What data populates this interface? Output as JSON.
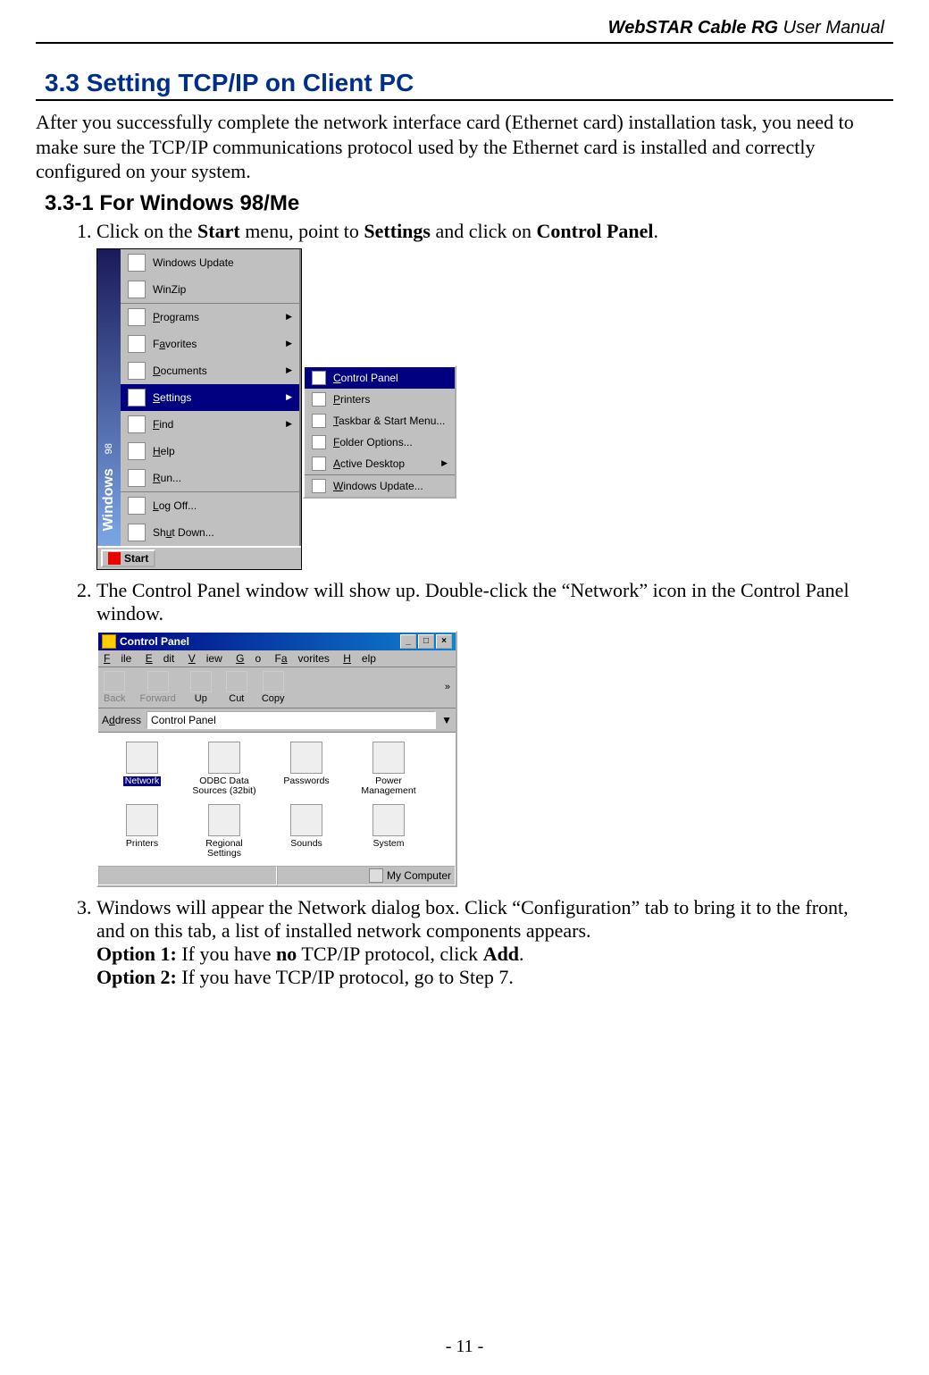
{
  "header": {
    "product": "WebSTAR Cable RG",
    "rest": " User Manual"
  },
  "section": {
    "title": "3.3 Setting TCP/IP on Client PC",
    "intro": "After you successfully complete the network interface card (Ethernet card) installation task, you need to make sure the TCP/IP communications protocol used by the Ethernet card is installed and correctly configured on your system.",
    "sub": "3.3-1 For Windows 98/Me"
  },
  "steps": {
    "s1": {
      "a": "Click on the ",
      "b": "Start",
      "c": " menu, point to ",
      "d": "Settings",
      "e": " and click on ",
      "f": "Control Panel",
      "g": "."
    },
    "s2": "The Control Panel window will show up. Double-click the “Network” icon in the Control Panel window.",
    "s3": {
      "l1": "Windows will appear the Network dialog box. Click “Configuration” tab to bring it to the front, and on this tab, a list of installed network components appears.",
      "o1a": "Option 1:",
      "o1b": " If you have ",
      "o1c": "no",
      "o1d": " TCP/IP protocol, click ",
      "o1e": "Add",
      "o1f": ".",
      "o2a": "Option 2:",
      "o2b": " If you have TCP/IP protocol, go to Step 7."
    }
  },
  "startmenu": {
    "sidebar": {
      "brand": "Windows",
      "ver": "98"
    },
    "items": [
      {
        "label": "Windows Update",
        "arrow": false
      },
      {
        "label": "WinZip",
        "arrow": false
      },
      {
        "label": "Programs",
        "arrow": true
      },
      {
        "label": "Favorites",
        "arrow": true
      },
      {
        "label": "Documents",
        "arrow": true
      },
      {
        "label": "Settings",
        "arrow": true
      },
      {
        "label": "Find",
        "arrow": true
      },
      {
        "label": "Help",
        "arrow": false
      },
      {
        "label": "Run...",
        "arrow": false
      },
      {
        "label": "Log Off...",
        "arrow": false
      },
      {
        "label": "Shut Down...",
        "arrow": false
      }
    ],
    "submenu": [
      {
        "label": "Control Panel",
        "arrow": false
      },
      {
        "label": "Printers",
        "arrow": false
      },
      {
        "label": "Taskbar & Start Menu...",
        "arrow": false
      },
      {
        "label": "Folder Options...",
        "arrow": false
      },
      {
        "label": "Active Desktop",
        "arrow": true
      },
      {
        "label": "Windows Update...",
        "arrow": false
      }
    ],
    "start": "Start"
  },
  "cp": {
    "title": "Control Panel",
    "menu": [
      "File",
      "Edit",
      "View",
      "Go",
      "Favorites",
      "Help"
    ],
    "tools": [
      "Back",
      "Forward",
      "Up",
      "Cut",
      "Copy"
    ],
    "addr_label": "Address",
    "addr_value": "Control Panel",
    "icons": [
      "Network",
      "ODBC Data Sources (32bit)",
      "Passwords",
      "Power Management",
      "Printers",
      "Regional Settings",
      "Sounds",
      "System"
    ],
    "status": "My Computer"
  },
  "footer": "- 11 -"
}
